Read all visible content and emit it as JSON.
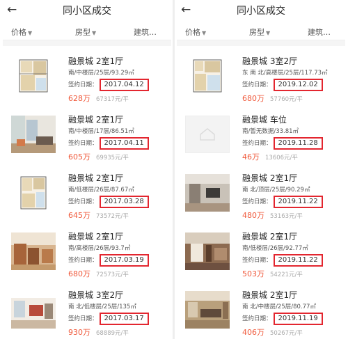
{
  "left": {
    "title": "同小区成交",
    "back_icon": "arrow-left-icon",
    "filters": [
      "价格",
      "房型",
      "建筑…"
    ],
    "items": [
      {
        "name": "融景城 2室1厅",
        "spec": "南/中楼层/25层/93.29㎡",
        "date_label": "签约日期：",
        "date": "2017.04.12",
        "price": "628万",
        "unit_price": "67317元/平"
      },
      {
        "name": "融景城 2室1厅",
        "spec": "南/中楼层/17层/86.51㎡",
        "date_label": "签约日期：",
        "date": "2017.04.11",
        "price": "605万",
        "unit_price": "69935元/平"
      },
      {
        "name": "融景城 2室1厅",
        "spec": "南/低楼层/26层/87.67㎡",
        "date_label": "签约日期：",
        "date": "2017.03.28",
        "price": "645万",
        "unit_price": "73572元/平"
      },
      {
        "name": "融景城 2室1厅",
        "spec": "南/高楼层/26层/93.7㎡",
        "date_label": "签约日期：",
        "date": "2017.03.19",
        "price": "680万",
        "unit_price": "72573元/平"
      },
      {
        "name": "融景城 3室2厅",
        "spec": "南 北/低楼层/25层/135㎡",
        "date_label": "签约日期：",
        "date": "2017.03.17",
        "price": "930万",
        "unit_price": "68889元/平"
      }
    ]
  },
  "right": {
    "title": "同小区成交",
    "back_icon": "arrow-left-icon",
    "filters": [
      "价格",
      "房型",
      "建筑…"
    ],
    "items": [
      {
        "name": "融景城 3室2厅",
        "spec": "东 南 北/高楼层/25层/117.73㎡",
        "date_label": "签约日期：",
        "date": "2019.12.02",
        "price": "680万",
        "unit_price": "57760元/平"
      },
      {
        "name": "融景城 车位",
        "spec": "南/暂无数据/33.81㎡",
        "date_label": "签约日期：",
        "date": "2019.11.28",
        "price": "46万",
        "unit_price": "13606元/平"
      },
      {
        "name": "融景城 2室1厅",
        "spec": "南 北/顶层/25层/90.29㎡",
        "date_label": "签约日期：",
        "date": "2019.11.22",
        "price": "480万",
        "unit_price": "53163元/平"
      },
      {
        "name": "融景城 2室1厅",
        "spec": "南/低楼层/26层/92.77㎡",
        "date_label": "签约日期：",
        "date": "2019.11.22",
        "price": "503万",
        "unit_price": "54221元/平"
      },
      {
        "name": "融景城 2室1厅",
        "spec": "南 北/中楼层/25层/80.77㎡",
        "date_label": "签约日期：",
        "date": "2019.11.19",
        "price": "406万",
        "unit_price": "50267元/平"
      }
    ]
  },
  "colors": {
    "accent": "#f05a3c",
    "highlight_box": "#e3262f"
  }
}
